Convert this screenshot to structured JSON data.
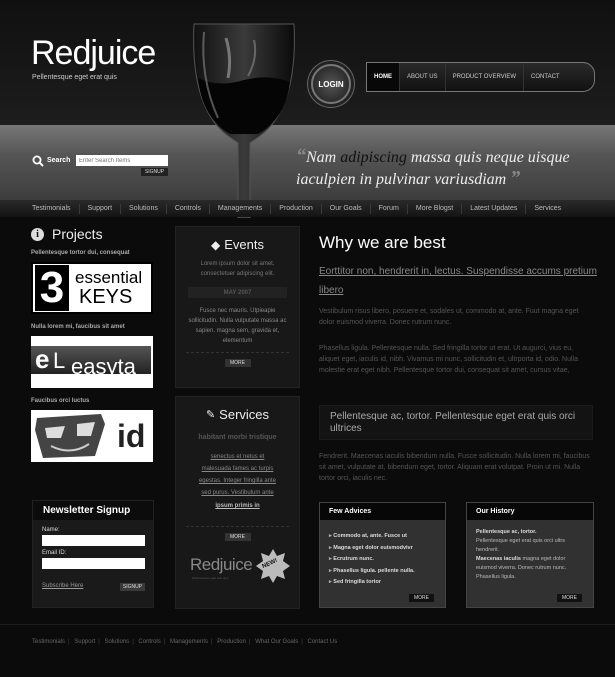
{
  "brand": {
    "name": "Redjuice",
    "tagline": "Pellentesque eget erat quis"
  },
  "login": {
    "label": "LOGIN"
  },
  "nav": {
    "items": [
      "HOME",
      "ABOUT US",
      "PRODUCT OVERVIEW",
      "CONTACT"
    ],
    "active": "HOME"
  },
  "search": {
    "label": "Search",
    "placeholder": "Enter Search Items",
    "button": "SIGNUP"
  },
  "quote": {
    "part1": "Nam ",
    "highlight": "adipiscing",
    "part2": " massa quis neque uisque iaculpien in pulvinar variusdiam"
  },
  "subnav": {
    "items": [
      "Testimonials",
      "Support",
      "Solutions",
      "Controls",
      "Managements",
      "Production",
      "Our Goals",
      "Forum",
      "More Blogst",
      "Latest Updates",
      "Services"
    ]
  },
  "projects": {
    "title": "Projects",
    "items": [
      {
        "caption": "Pellentesque tortor dui, consequat",
        "logo": {
          "num": "3",
          "line1": "essential",
          "line2": "KEYS"
        }
      },
      {
        "caption": "Nulla lorem mi, faucibus sit amet",
        "logo": {
          "a": "e",
          "b": "L",
          "c": "easyta"
        }
      },
      {
        "caption": "Faucibus orci luctus",
        "logo": {
          "text": "id"
        }
      }
    ]
  },
  "newsletter": {
    "title": "Newsletter Signup",
    "name_label": "Name:",
    "email_label": "Email ID:",
    "subscribe": "Subscribe Here",
    "button": "SIGNUP"
  },
  "events": {
    "title": "Events",
    "intro": "Lorem ipsum dolor sit amet, consectetuer adipiscing elit.",
    "date": "MAY 2007",
    "text": "Fusce nec mauris. Utpieapie sollicitudin. Nulla vulputate massa ac sapien. magna sem, gravida et, elementum",
    "more": "MORE"
  },
  "services": {
    "title": "Services",
    "subtitle": "habitant morbi tristique",
    "links": [
      "senectus et netus et",
      "malesuada fames ac turpis",
      "egestas. Integer fringilla ante",
      "sed purus. Vestibulum ante"
    ],
    "bold_link": "ipsum primis in",
    "more": "MORE",
    "badge_brand": "Redjuice",
    "badge_sub": "Pellentesque eget erat quis",
    "badge_new": "NEW!"
  },
  "why": {
    "title": "Why we are best",
    "link": "Eorttitor non, hendrerit in, lectus. Suspendisse accums pretium libero",
    "p1": "Vestibulum risus libero, posuere et, sodales ut, commodo at, ante. Fuut magna eget dolor euismod viverra. Donec rutrum nunc.",
    "p2": "Phasellus ligula. Pellentesque nulla. Sed fringilla tortor ut erat. Ut augurci, vius eu, aliquet eget, iaculis id, nibh. Vivamus mi nunc, sollicitudin et, ultrporta id, odio. Nulla molestie erat eget nibh. Pellentesque tortor dui, consequat sit amet, cursus vitae,",
    "highlight": "Pellentesque ac, tortor. Pellentesque eget erat quis orci ultrices",
    "p3": "Fendrerit. Maecenas iaculis bibendum nulla. Fusce sollicitudin. Nulla lorem mi, faucibus sit amet, vulputate at, bibendum eget, tortor. Aliquam erat volutpat. Proin ut mi. Nulla tortor orci, iaculis nec."
  },
  "advices": {
    "title": "Few Advices",
    "items": [
      "Commodo at, ante. Fusce ut",
      "Magna eget dolor euismodvivr",
      "Ecrutrum nunc.",
      "Phasellus ligula. pellente nulla.",
      "Sed fringilla tortor"
    ],
    "more": "MORE"
  },
  "history": {
    "title": "Our History",
    "bold1": "Pellentesque ac, tortor.",
    "text1": "Pellentesque eget erat quis orci ultrs hendrerit.",
    "bold2": "Maecenas iaculis",
    "text2": "magna eget dolor euismod viverra. Donec rutrum nunc. Phasellus ligula.",
    "more": "MORE"
  },
  "footer": {
    "items": [
      "Testimonials",
      "Support",
      "Solutions",
      "Controls",
      "Managements",
      "Production",
      "What Our Goals",
      "Contact Us"
    ]
  }
}
